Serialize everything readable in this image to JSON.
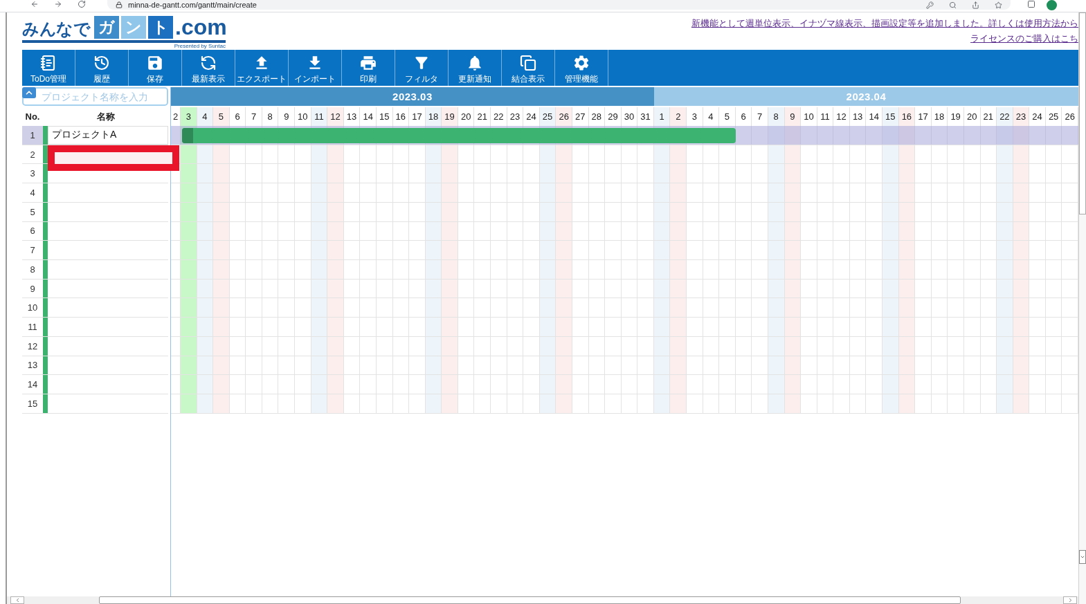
{
  "browser": {
    "url": "minna-de-gantt.com/gantt/main/create"
  },
  "header": {
    "logo": {
      "prefix": "みんなで",
      "boxed": [
        {
          "text": "ガ",
          "color": "#3e8cc9"
        },
        {
          "text": "ン",
          "color": "#8fc6ea"
        },
        {
          "text": "ト",
          "color": "#1d6fc0"
        }
      ],
      "suffix": ".com",
      "tagline": "Presented by Suntac"
    },
    "notices": [
      {
        "text": "新機能として週単位表示、イナヅマ線表示、描画設定等を追加しました。詳しくは使用方法から"
      },
      {
        "text": "ライセンスのご購入はこち"
      }
    ]
  },
  "toolbar": [
    {
      "kind": "todo",
      "label": "ToDo管理"
    },
    {
      "kind": "history",
      "label": "履歴"
    },
    {
      "kind": "save",
      "label": "保存"
    },
    {
      "kind": "refresh",
      "label": "最新表示"
    },
    {
      "kind": "export",
      "label": "エクスポート"
    },
    {
      "kind": "import",
      "label": "インポート"
    },
    {
      "kind": "print",
      "label": "印刷"
    },
    {
      "kind": "filter",
      "label": "フィルタ"
    },
    {
      "kind": "notify",
      "label": "更新通知"
    },
    {
      "kind": "merge",
      "label": "結合表示"
    },
    {
      "kind": "admin",
      "label": "管理機能"
    }
  ],
  "search": {
    "placeholder": "プロジェクト名称を入力"
  },
  "list": {
    "columns": [
      "No.",
      "名称"
    ]
  },
  "timeline": {
    "months": [
      {
        "label": "2023.03",
        "current": true,
        "days": [
          {
            "label": "2",
            "kind": "weekday"
          },
          {
            "label": "3",
            "kind": "today"
          },
          {
            "label": "4",
            "kind": "saturday"
          },
          {
            "label": "5",
            "kind": "sunday"
          },
          {
            "label": "6",
            "kind": "weekday"
          },
          {
            "label": "7",
            "kind": "weekday"
          },
          {
            "label": "8",
            "kind": "weekday"
          },
          {
            "label": "9",
            "kind": "weekday"
          },
          {
            "label": "10",
            "kind": "weekday"
          },
          {
            "label": "11",
            "kind": "saturday"
          },
          {
            "label": "12",
            "kind": "sunday"
          },
          {
            "label": "13",
            "kind": "weekday"
          },
          {
            "label": "14",
            "kind": "weekday"
          },
          {
            "label": "15",
            "kind": "weekday"
          },
          {
            "label": "16",
            "kind": "weekday"
          },
          {
            "label": "17",
            "kind": "weekday"
          },
          {
            "label": "18",
            "kind": "saturday"
          },
          {
            "label": "19",
            "kind": "sunday"
          },
          {
            "label": "20",
            "kind": "weekday"
          },
          {
            "label": "21",
            "kind": "weekday"
          },
          {
            "label": "22",
            "kind": "weekday"
          },
          {
            "label": "23",
            "kind": "weekday"
          },
          {
            "label": "24",
            "kind": "weekday"
          },
          {
            "label": "25",
            "kind": "saturday"
          },
          {
            "label": "26",
            "kind": "sunday"
          },
          {
            "label": "27",
            "kind": "weekday"
          },
          {
            "label": "28",
            "kind": "weekday"
          },
          {
            "label": "29",
            "kind": "weekday"
          },
          {
            "label": "30",
            "kind": "weekday"
          },
          {
            "label": "31",
            "kind": "weekday"
          }
        ]
      },
      {
        "label": "2023.04",
        "current": false,
        "days": [
          {
            "label": "1",
            "kind": "saturday"
          },
          {
            "label": "2",
            "kind": "sunday"
          },
          {
            "label": "3",
            "kind": "weekday"
          },
          {
            "label": "4",
            "kind": "weekday"
          },
          {
            "label": "5",
            "kind": "weekday"
          },
          {
            "label": "6",
            "kind": "weekday"
          },
          {
            "label": "7",
            "kind": "weekday"
          },
          {
            "label": "8",
            "kind": "saturday"
          },
          {
            "label": "9",
            "kind": "sunday"
          },
          {
            "label": "10",
            "kind": "weekday"
          },
          {
            "label": "11",
            "kind": "weekday"
          },
          {
            "label": "12",
            "kind": "weekday"
          },
          {
            "label": "13",
            "kind": "weekday"
          },
          {
            "label": "14",
            "kind": "weekday"
          },
          {
            "label": "15",
            "kind": "saturday"
          },
          {
            "label": "16",
            "kind": "sunday"
          },
          {
            "label": "17",
            "kind": "weekday"
          },
          {
            "label": "18",
            "kind": "weekday"
          },
          {
            "label": "19",
            "kind": "weekday"
          },
          {
            "label": "20",
            "kind": "weekday"
          },
          {
            "label": "21",
            "kind": "weekday"
          },
          {
            "label": "22",
            "kind": "saturday"
          },
          {
            "label": "23",
            "kind": "sunday"
          },
          {
            "label": "24",
            "kind": "weekday"
          },
          {
            "label": "25",
            "kind": "weekday"
          },
          {
            "label": "26",
            "kind": "weekday"
          }
        ]
      }
    ]
  },
  "rows": [
    {
      "no": "1",
      "name": "プロジェクトA",
      "selected": true,
      "editing": false,
      "bar": {
        "days": [
          false,
          true,
          true,
          true,
          true,
          true,
          true,
          true,
          true,
          true,
          true,
          true,
          true,
          true,
          true,
          true,
          true,
          true,
          true,
          true,
          true,
          true,
          true,
          true,
          true,
          true,
          true,
          true,
          true,
          true,
          true,
          true,
          true,
          true,
          true,
          false,
          false,
          false,
          false,
          false,
          false,
          false,
          false,
          false,
          false,
          false,
          false,
          false,
          false,
          false,
          false,
          false,
          false,
          false,
          false,
          false
        ]
      }
    },
    {
      "no": "2",
      "selected": false,
      "editing": true
    },
    {
      "no": "3",
      "selected": false,
      "editing": false
    },
    {
      "no": "4",
      "selected": false,
      "editing": false
    },
    {
      "no": "5",
      "selected": false,
      "editing": false
    },
    {
      "no": "6",
      "selected": false,
      "editing": false
    },
    {
      "no": "7",
      "selected": false,
      "editing": false
    },
    {
      "no": "8",
      "selected": false,
      "editing": false
    },
    {
      "no": "9",
      "selected": false,
      "editing": false
    },
    {
      "no": "10",
      "selected": false,
      "editing": false
    },
    {
      "no": "11",
      "selected": false,
      "editing": false
    },
    {
      "no": "12",
      "selected": false,
      "editing": false
    },
    {
      "no": "13",
      "selected": false,
      "editing": false
    },
    {
      "no": "14",
      "selected": false,
      "editing": false
    },
    {
      "no": "15",
      "selected": false,
      "editing": false
    }
  ]
}
